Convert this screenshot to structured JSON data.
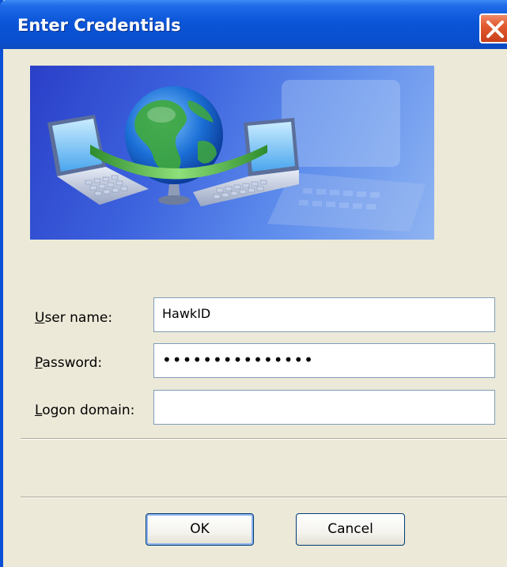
{
  "window": {
    "title": "Enter Credentials"
  },
  "icons": {
    "close": "close-icon",
    "banner": "network-globe-laptops-illustration"
  },
  "form": {
    "username": {
      "label_accel": "U",
      "label_rest": "ser name:",
      "value": "HawkID"
    },
    "password": {
      "label_accel": "P",
      "label_rest": "assword:",
      "value": "•••••••••••••••"
    },
    "domain": {
      "label_accel": "L",
      "label_rest": "ogon domain:",
      "value": ""
    }
  },
  "buttons": {
    "ok": "OK",
    "cancel": "Cancel"
  },
  "colors": {
    "titlebar": "#0a4fd6",
    "dialog_bg": "#ece9d8",
    "close": "#e25a30"
  }
}
